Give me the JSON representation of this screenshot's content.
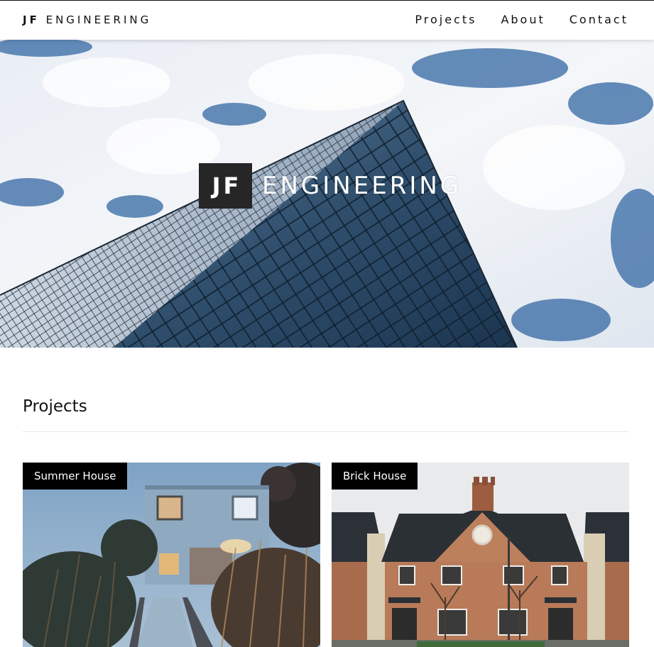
{
  "nav": {
    "brand_bold": "JF",
    "brand_rest": "ENGINEERING",
    "links": [
      "Projects",
      "About",
      "Contact"
    ]
  },
  "hero": {
    "badge": "JF",
    "title": "ENGINEERING"
  },
  "projects": {
    "heading": "Projects",
    "cards": [
      {
        "label": "Summer House"
      },
      {
        "label": "Brick House"
      }
    ]
  },
  "colors": {
    "nav_bg": "#ffffff",
    "label_bg": "#000000",
    "hero_badge_bg": "#262626",
    "sky_blue": "#3f6ea8"
  }
}
